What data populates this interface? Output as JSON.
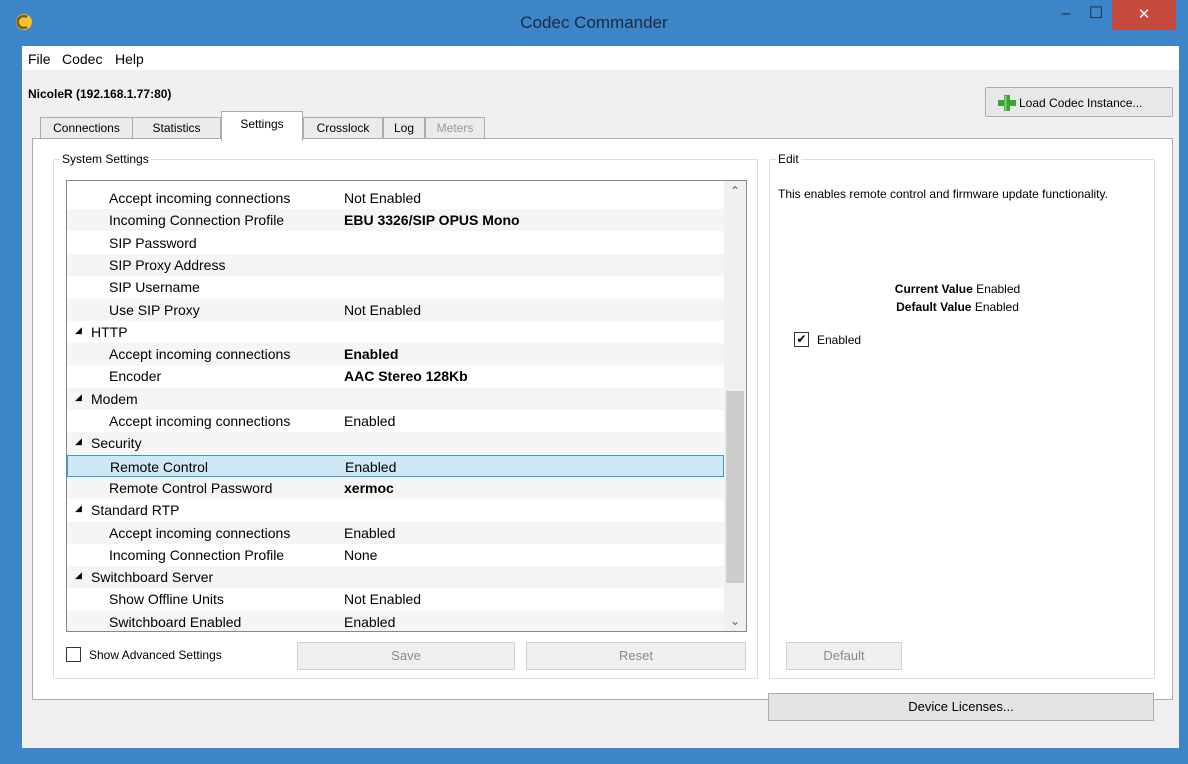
{
  "window": {
    "title": "Codec Commander",
    "controls": {
      "minimize": "–",
      "maximize": "☐",
      "close": "✕"
    }
  },
  "menu": [
    "File",
    "Codec",
    "Help"
  ],
  "device_label": "NicoleR (192.168.1.77:80)",
  "load_button": "Load Codec Instance...",
  "tabs": [
    {
      "label": "Connections",
      "state": "normal"
    },
    {
      "label": "Statistics",
      "state": "normal"
    },
    {
      "label": "Settings",
      "state": "active"
    },
    {
      "label": "Crosslock",
      "state": "normal"
    },
    {
      "label": "Log",
      "state": "normal"
    },
    {
      "label": "Meters",
      "state": "disabled"
    }
  ],
  "system_settings": {
    "title": "System Settings",
    "rows": [
      {
        "type": "prop",
        "key": "Accept incoming connections",
        "value": "Not Enabled",
        "bold": false
      },
      {
        "type": "prop",
        "key": "Incoming Connection Profile",
        "value": "EBU 3326/SIP OPUS Mono",
        "bold": true
      },
      {
        "type": "prop",
        "key": "SIP Password",
        "value": "",
        "bold": false
      },
      {
        "type": "prop",
        "key": "SIP Proxy Address",
        "value": "",
        "bold": false
      },
      {
        "type": "prop",
        "key": "SIP Username",
        "value": "",
        "bold": false
      },
      {
        "type": "prop",
        "key": "Use SIP Proxy",
        "value": "Not Enabled",
        "bold": false
      },
      {
        "type": "category",
        "key": "HTTP"
      },
      {
        "type": "prop",
        "key": "Accept incoming connections",
        "value": "Enabled",
        "bold": true
      },
      {
        "type": "prop",
        "key": "Encoder",
        "value": "AAC Stereo 128Kb",
        "bold": true
      },
      {
        "type": "category",
        "key": "Modem"
      },
      {
        "type": "prop",
        "key": "Accept incoming connections",
        "value": "Enabled",
        "bold": false
      },
      {
        "type": "category",
        "key": "Security"
      },
      {
        "type": "prop",
        "key": "Remote Control",
        "value": "Enabled",
        "bold": false,
        "selected": true
      },
      {
        "type": "prop",
        "key": "Remote Control Password",
        "value": "xermoc",
        "bold": true
      },
      {
        "type": "category",
        "key": "Standard RTP"
      },
      {
        "type": "prop",
        "key": "Accept incoming connections",
        "value": "Enabled",
        "bold": false
      },
      {
        "type": "prop",
        "key": "Incoming Connection Profile",
        "value": "None",
        "bold": false
      },
      {
        "type": "category",
        "key": "Switchboard Server"
      },
      {
        "type": "prop",
        "key": "Show Offline Units",
        "value": "Not Enabled",
        "bold": false
      },
      {
        "type": "prop",
        "key": "Switchboard Enabled",
        "value": "Enabled",
        "bold": false
      }
    ],
    "show_advanced_label": "Show Advanced Settings",
    "show_advanced_checked": false,
    "save_button": "Save",
    "reset_button": "Reset"
  },
  "edit": {
    "title": "Edit",
    "description": "This enables remote control and firmware update functionality.",
    "current_value_label": "Current Value",
    "current_value": "Enabled",
    "default_value_label": "Default Value",
    "default_value": "Enabled",
    "checkbox_label": "Enabled",
    "checkbox_checked": true,
    "default_button": "Default"
  },
  "device_licenses_button": "Device Licenses...",
  "icons": {
    "category_expand": "▲-expanded-triangle",
    "scroll_up": "chevron-up",
    "scroll_down": "chevron-down",
    "checkmark": "✔"
  },
  "colors": {
    "titlebar": "#3c85c9",
    "close_button": "#c74a3f",
    "selection_fill": "#cfe8f5",
    "selection_border": "#26a0da"
  }
}
